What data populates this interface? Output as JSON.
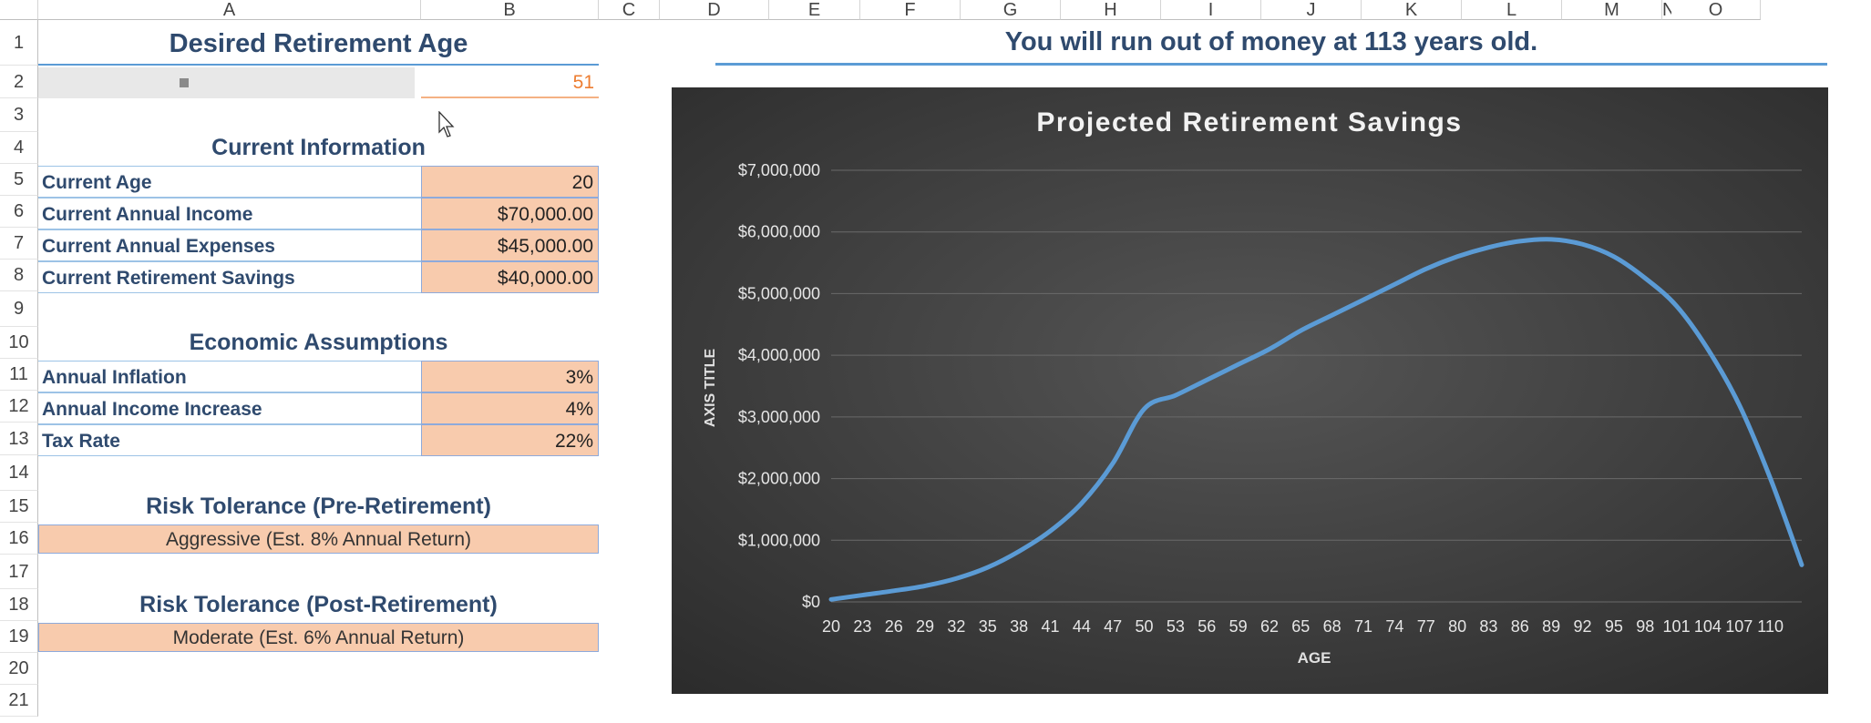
{
  "columns": [
    "A",
    "B",
    "C",
    "D",
    "E",
    "F",
    "G",
    "H",
    "I",
    "J",
    "K",
    "L",
    "M",
    "N",
    "O"
  ],
  "rows": [
    "1",
    "2",
    "3",
    "4",
    "5",
    "6",
    "7",
    "8",
    "9",
    "10",
    "11",
    "12",
    "13",
    "14",
    "15",
    "16",
    "17",
    "18",
    "19",
    "20",
    "21"
  ],
  "sheet": {
    "title": "Desired Retirement Age",
    "retirement_age": "51",
    "current_info_title": "Current Information",
    "current_info": [
      {
        "label": "Current Age",
        "value": "20"
      },
      {
        "label": "Current Annual Income",
        "value": "$70,000.00"
      },
      {
        "label": "Current Annual Expenses",
        "value": "$45,000.00"
      },
      {
        "label": "Current Retirement Savings",
        "value": "$40,000.00"
      }
    ],
    "econ_title": "Economic Assumptions",
    "econ": [
      {
        "label": "Annual Inflation",
        "value": "3%"
      },
      {
        "label": "Annual Income Increase",
        "value": "4%"
      },
      {
        "label": "Tax Rate",
        "value": "22%"
      }
    ],
    "risk_pre_title": "Risk Tolerance (Pre-Retirement)",
    "risk_pre_value": "Aggressive  (Est. 8% Annual Return)",
    "risk_post_title": "Risk Tolerance (Post-Retirement)",
    "risk_post_value": "Moderate  (Est. 6% Annual Return)"
  },
  "headline": "You will run out of money at 113 years old.",
  "colors": {
    "accent": "#5b9bd5",
    "input_fill": "#f8cbad",
    "heading": "#2f4a6e",
    "retire_value": "#ed7d31",
    "chart_bg": "#3a3a3a"
  },
  "chart_data": {
    "type": "line",
    "title": "Projected Retirement Savings",
    "xlabel": "AGE",
    "ylabel": "AXIS TITLE",
    "ylim": [
      0,
      7000000
    ],
    "yticks": [
      "$0",
      "$1,000,000",
      "$2,000,000",
      "$3,000,000",
      "$4,000,000",
      "$5,000,000",
      "$6,000,000",
      "$7,000,000"
    ],
    "xticks": [
      "20",
      "23",
      "26",
      "29",
      "32",
      "35",
      "38",
      "41",
      "44",
      "47",
      "50",
      "53",
      "56",
      "59",
      "62",
      "65",
      "68",
      "71",
      "74",
      "77",
      "80",
      "83",
      "86",
      "89",
      "92",
      "95",
      "98",
      "101",
      "104",
      "107",
      "110"
    ],
    "grid": true,
    "legend": "none",
    "series": [
      {
        "x": [
          20,
          23,
          26,
          29,
          32,
          35,
          38,
          41,
          44,
          47,
          50,
          53,
          56,
          59,
          62,
          65,
          68,
          71,
          74,
          77,
          80,
          83,
          86,
          89,
          92,
          95,
          98,
          101,
          104,
          107,
          110,
          113
        ],
        "values": [
          40000,
          110000,
          180000,
          260000,
          380000,
          560000,
          820000,
          1150000,
          1600000,
          2250000,
          3130000,
          3350000,
          3600000,
          3850000,
          4100000,
          4400000,
          4650000,
          4900000,
          5150000,
          5400000,
          5600000,
          5750000,
          5850000,
          5880000,
          5800000,
          5600000,
          5250000,
          4800000,
          4100000,
          3200000,
          2000000,
          600000
        ]
      }
    ]
  }
}
